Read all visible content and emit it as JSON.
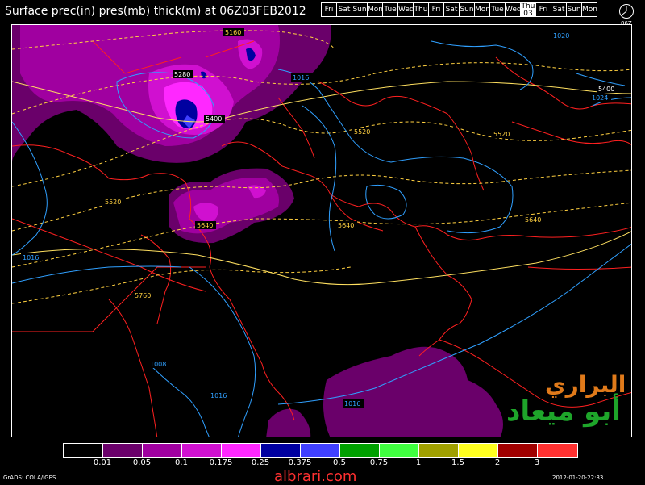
{
  "title": "Surface prec(in) pres(mb) thick(m) at 06Z03FEB2012",
  "days": [
    "Fri",
    "Sat",
    "Sun",
    "Mon",
    "Tue",
    "Wed",
    "Thu",
    "Fri",
    "Sat",
    "Sun",
    "Mon",
    "Tue",
    "Wed",
    "Thu",
    "Fri",
    "Sat",
    "Sun",
    "Mon"
  ],
  "current_day_date": "03",
  "clock_label": "06Z",
  "contour_labels": {
    "thick_5160": "5160",
    "thick_5280": "5280",
    "thick_5400_a": "5400",
    "thick_5400_b": "5400",
    "thick_5520_a": "5520",
    "thick_5520_b": "5520",
    "thick_5520_c": "5520",
    "thick_5640_a": "5640",
    "thick_5640_b": "5640",
    "thick_5640_c": "5640",
    "thick_5760": "5760",
    "pres_1016_a": "1016",
    "pres_1016_b": "1016",
    "pres_1016_c": "1016",
    "pres_1016_d": "1016",
    "pres_1008": "1008",
    "pres_1024": "1024",
    "pres_1020": "1020"
  },
  "legend": {
    "colors": [
      "#000000",
      "#6a006a",
      "#a000a0",
      "#d010d0",
      "#ff28ff",
      "#0000a0",
      "#4040ff",
      "#00a000",
      "#40ff40",
      "#a0a000",
      "#ffff20",
      "#a00000",
      "#ff3030"
    ],
    "ticks": [
      "0.01",
      "0.05",
      "0.1",
      "0.175",
      "0.25",
      "0.375",
      "0.5",
      "0.75",
      "1",
      "1.5",
      "2",
      "3"
    ]
  },
  "colors": {
    "coast": "#ff2020",
    "pressure": "#30a0ff",
    "thickness": "#ffd040"
  },
  "footer": {
    "left": "GrADS: COLA/IGES",
    "center": "albrari.com",
    "right": "2012-01-20-22:33"
  },
  "logo": {
    "line1": "البراري",
    "line2": "أبو ميعاد"
  }
}
